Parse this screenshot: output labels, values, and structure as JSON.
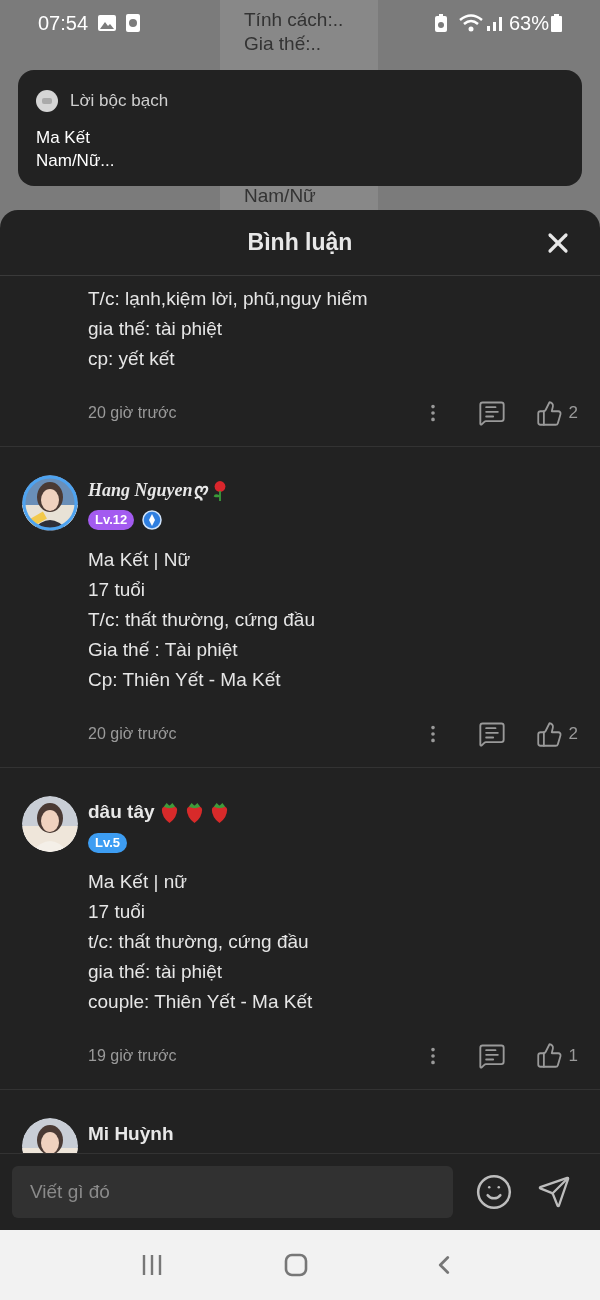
{
  "status_bar": {
    "time": "07:54",
    "battery": "63%"
  },
  "background_page": {
    "lines": [
      "Tính cách:..",
      "Gia thế:.."
    ],
    "bottom_line": "Nam/Nữ"
  },
  "notification": {
    "app": "Lời bộc bạch",
    "body": [
      "Ma Kết",
      "Nam/Nữ..."
    ]
  },
  "sheet": {
    "title": "Bình luận"
  },
  "comments": [
    {
      "kind": "partial",
      "lines": [
        "T/c: lạnh,kiệm lời, phũ,nguy hiểm",
        "gia thế: tài phiệt",
        "cp: yết kết"
      ],
      "time": "20 giờ trước",
      "likes": "2"
    },
    {
      "kind": "full",
      "author": {
        "name": "Hang Nguyenღ",
        "kind": "script",
        "decor": [
          {
            "kind": "rose"
          }
        ],
        "level": "Lv.12",
        "color": "#a35bf0",
        "medal": true
      },
      "lines": [
        "Ma Kết | Nữ",
        "17 tuổi",
        "T/c: thất thường, cứng đầu",
        "Gia thế : Tài phiệt",
        "Cp: Thiên Yết - Ma Kết"
      ],
      "time": "20 giờ trước",
      "likes": "2"
    },
    {
      "kind": "full",
      "author": {
        "name": "dâu tây",
        "kind": "plain",
        "decor": [
          {
            "kind": "strawberry"
          },
          {
            "kind": "strawberry"
          },
          {
            "kind": "strawberry"
          }
        ],
        "level": "Lv.5",
        "color": "#3d9df2",
        "medal": false
      },
      "lines": [
        "Ma Kết | nữ",
        "17 tuổi",
        "t/c: thất thường, cứng đầu",
        "gia thế: tài phiệt",
        "couple: Thiên Yết - Ma Kết"
      ],
      "time": "19 giờ trước",
      "likes": "1"
    },
    {
      "kind": "header_only",
      "author": {
        "name": "Mi Huỳnh",
        "kind": "plain"
      }
    }
  ],
  "composer": {
    "placeholder": "Viết gì đó"
  }
}
